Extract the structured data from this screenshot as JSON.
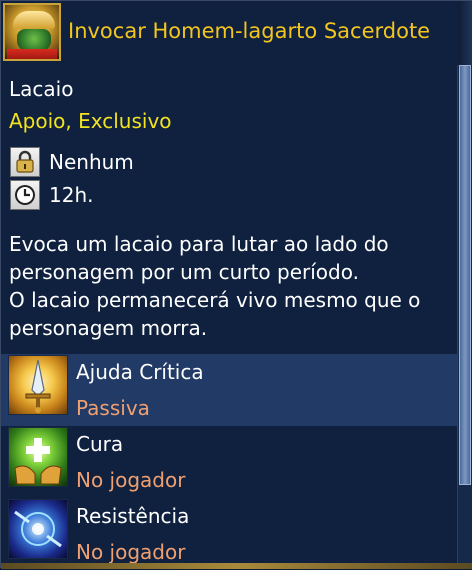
{
  "header": {
    "title": "Invocar Homem-lagarto Sacerdote",
    "portrait_icon": "lizardman-priest-portrait-icon"
  },
  "info": {
    "type": "Lacaio",
    "tags": "Apoio, Exclusivo",
    "lock_label": "Nenhum",
    "duration_label": "12h."
  },
  "description": {
    "line1": "Evoca um lacaio para lutar ao lado do",
    "line2": "personagem por um curto período.",
    "line3": "O lacaio permanecerá vivo mesmo que o",
    "line4": "personagem morra."
  },
  "skills": [
    {
      "name": "Ajuda Crítica",
      "target": "Passiva",
      "icon": "sword-burst-icon"
    },
    {
      "name": "Cura",
      "target": "No jogador",
      "icon": "heal-hands-icon"
    },
    {
      "name": "Resistência",
      "target": "No jogador",
      "icon": "resistance-orb-icon"
    }
  ],
  "colors": {
    "title": "#f2c51f",
    "tags": "#f2e21f",
    "skill_target": "#f0a070",
    "highlight_row": "#213a66",
    "background": "#0f213f"
  }
}
